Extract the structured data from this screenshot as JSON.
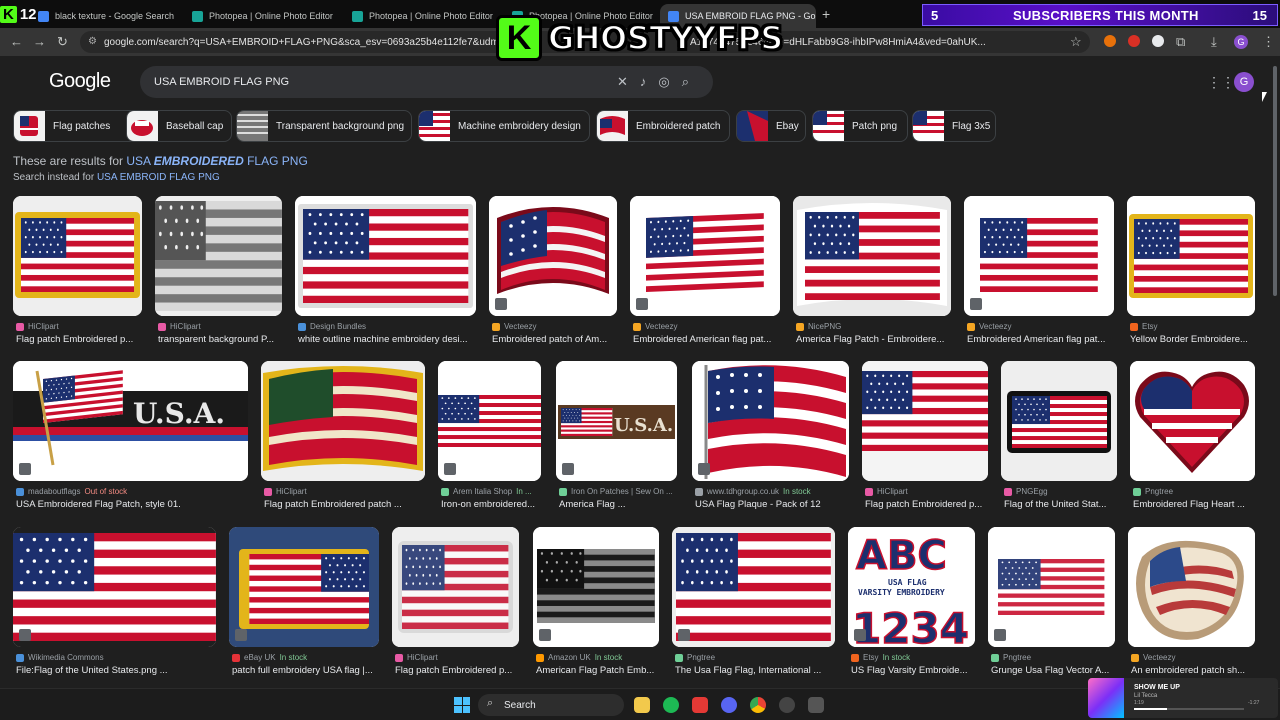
{
  "tabs": [
    {
      "title": "black texture - Google Search",
      "color": "#4285f4"
    },
    {
      "title": "Photopea | Online Photo Editor",
      "color": "#18a497"
    },
    {
      "title": "Photopea | Online Photo Editor",
      "color": "#18a497"
    },
    {
      "title": "Photopea | Online Photo Editor",
      "color": "#18a497"
    },
    {
      "title": "USA EMBROID FLAG PNG - Go",
      "color": "#4285f4"
    }
  ],
  "overlay": {
    "k_label": "K",
    "k_number": "12",
    "logo_text": "GHOSTYYFPS",
    "logo_k": "K",
    "subs_left": "5",
    "subs_text": "SUBSCRIBERS THIS MONTH",
    "subs_right": "15"
  },
  "address": {
    "url": "google.com/search?q=USA+EMBROID+FLAG+PNG&sca_esv=0693a25b4e112fe7&udm=2&bi",
    "url_rest": "A1774547572464&ei=dHLFabb9G8-ihbIPw8HmiA4&ved=0ahUK..."
  },
  "google": {
    "logo": "Google",
    "query": "USA EMBROID FLAG PNG",
    "avatar": "G"
  },
  "chips": [
    {
      "label": "Flag patches"
    },
    {
      "label": "Baseball cap"
    },
    {
      "label": "Transparent background png"
    },
    {
      "label": "Machine embroidery design"
    },
    {
      "label": "Embroidered patch"
    },
    {
      "label": "Ebay"
    },
    {
      "label": "Patch png"
    },
    {
      "label": "Flag 3x5"
    }
  ],
  "notice": {
    "prefix": "These are results for ",
    "q1": "USA ",
    "q2": "EMBROIDERED",
    "q3": " FLAG PNG",
    "instead_prefix": "Search instead for ",
    "instead_link": "USA EMBROID FLAG PNG"
  },
  "results": [
    {
      "source": "HiClipart",
      "stock": "",
      "title": "Flag patch Embroidered p...",
      "color": "#e85aa5"
    },
    {
      "source": "HiClipart",
      "stock": "",
      "title": "transparent background P...",
      "color": "#e85aa5"
    },
    {
      "source": "Design Bundles",
      "stock": "",
      "title": "white outline machine embroidery desi...",
      "color": "#4a90d9"
    },
    {
      "source": "Vecteezy",
      "stock": "",
      "title": "Embroidered patch of Am...",
      "color": "#f5a623"
    },
    {
      "source": "Vecteezy",
      "stock": "",
      "title": "Embroidered American flag pat...",
      "color": "#f5a623"
    },
    {
      "source": "NicePNG",
      "stock": "",
      "title": "America Flag Patch - Embroidere...",
      "color": "#f5a623"
    },
    {
      "source": "Vecteezy",
      "stock": "",
      "title": "Embroidered American flag pat...",
      "color": "#f5a623"
    },
    {
      "source": "Etsy",
      "stock": "",
      "title": "Yellow Border Embroidere...",
      "color": "#f1641e"
    },
    {
      "source": "madaboutflags",
      "stock": "Out of stock",
      "title": "USA Embroidered Flag Patch, style 01.",
      "color": "#4a90d9"
    },
    {
      "source": "HiClipart",
      "stock": "",
      "title": "Flag patch Embroidered patch ...",
      "color": "#e85aa5"
    },
    {
      "source": "Arem Italia Shop",
      "stock": "In ...",
      "title": "Iron-on embroidered...",
      "color": "#6fcf97"
    },
    {
      "source": "Iron On Patches | Sew On ...",
      "stock": "",
      "title": "America Flag ...",
      "color": "#6fcf97"
    },
    {
      "source": "www.tdhgroup.co.uk",
      "stock": "In stock",
      "title": "USA Flag Plaque - Pack of 12",
      "color": "#9aa0a6"
    },
    {
      "source": "HiClipart",
      "stock": "",
      "title": "Flag patch Embroidered p...",
      "color": "#e85aa5"
    },
    {
      "source": "PNGEgg",
      "stock": "",
      "title": "Flag of the United Stat...",
      "color": "#e85aa5"
    },
    {
      "source": "Pngtree",
      "stock": "",
      "title": "Embroidered Flag Heart ...",
      "color": "#6fcf97"
    },
    {
      "source": "Wikimedia Commons",
      "stock": "",
      "title": "File:Flag of the United States.png ...",
      "color": "#4a90d9"
    },
    {
      "source": "eBay UK",
      "stock": "In stock",
      "title": "patch full embroidery USA flag |...",
      "color": "#e53238"
    },
    {
      "source": "HiClipart",
      "stock": "",
      "title": "Flag patch Embroidered p...",
      "color": "#e85aa5"
    },
    {
      "source": "Amazon UK",
      "stock": "In stock",
      "title": "American Flag Patch Emb...",
      "color": "#ff9900"
    },
    {
      "source": "Pngtree",
      "stock": "",
      "title": "The Usa Flag Flag, International ...",
      "color": "#6fcf97"
    },
    {
      "source": "Etsy",
      "stock": "In stock",
      "title": "US Flag Varsity Embroide...",
      "color": "#f1641e"
    },
    {
      "source": "Pngtree",
      "stock": "",
      "title": "Grunge Usa Flag Vector A...",
      "color": "#6fcf97"
    },
    {
      "source": "Vecteezy",
      "stock": "",
      "title": "An embroidered patch sh...",
      "color": "#f5a623"
    }
  ],
  "varsity": {
    "line1": "ABC",
    "line2": "USA FLAG",
    "line3": "VARSITY EMBROIDERY",
    "line4": "1234"
  },
  "usa_text": "U.S.A.",
  "taskbar": {
    "search": "Search",
    "song": "SHOW ME UP",
    "artist": "Lil Tecca",
    "time_elapsed": "1:19",
    "time_left": "-1:27"
  },
  "colors": {
    "red": "#c8102e",
    "blue": "#1c2f6e",
    "gold": "#e3b51a"
  }
}
